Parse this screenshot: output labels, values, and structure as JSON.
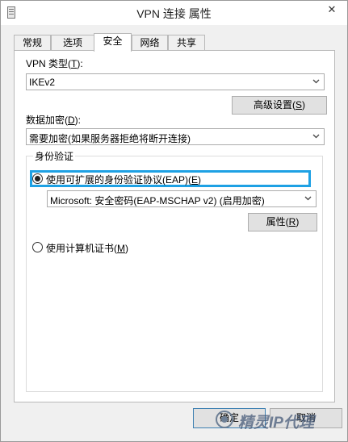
{
  "window": {
    "title": "VPN 连接 属性",
    "close_glyph": "✕"
  },
  "tabs": [
    {
      "label": "常规"
    },
    {
      "label": "选项"
    },
    {
      "label": "安全",
      "active": true
    },
    {
      "label": "网络"
    },
    {
      "label": "共享"
    }
  ],
  "vpn_type": {
    "label_prefix": "VPN 类型(",
    "label_key": "T",
    "label_suffix": "):",
    "value": "IKEv2"
  },
  "advanced": {
    "label_prefix": "高级设置(",
    "label_key": "S",
    "label_suffix": ")"
  },
  "encryption": {
    "label_prefix": "数据加密(",
    "label_key": "D",
    "label_suffix": "):",
    "value": "需要加密(如果服务器拒绝将断开连接)"
  },
  "auth": {
    "group_title": "身份验证",
    "eap_radio": {
      "label_prefix": "使用可扩展的身份验证协议(EAP)(",
      "label_key": "E",
      "label_suffix": ")",
      "checked": true
    },
    "eap_method": {
      "value": "Microsoft: 安全密码(EAP-MSCHAP v2) (启用加密)"
    },
    "properties": {
      "label_prefix": "属性(",
      "label_key": "R",
      "label_suffix": ")"
    },
    "cert_radio": {
      "label_prefix": "使用计算机证书(",
      "label_key": "M",
      "label_suffix": ")",
      "checked": false
    }
  },
  "footer": {
    "ok_label": "确定",
    "cancel_label": "取消"
  },
  "watermark": {
    "text": "精灵IP代理"
  },
  "colors": {
    "highlight": "#1ea1e4",
    "default_button_border": "#3c7fb1"
  }
}
